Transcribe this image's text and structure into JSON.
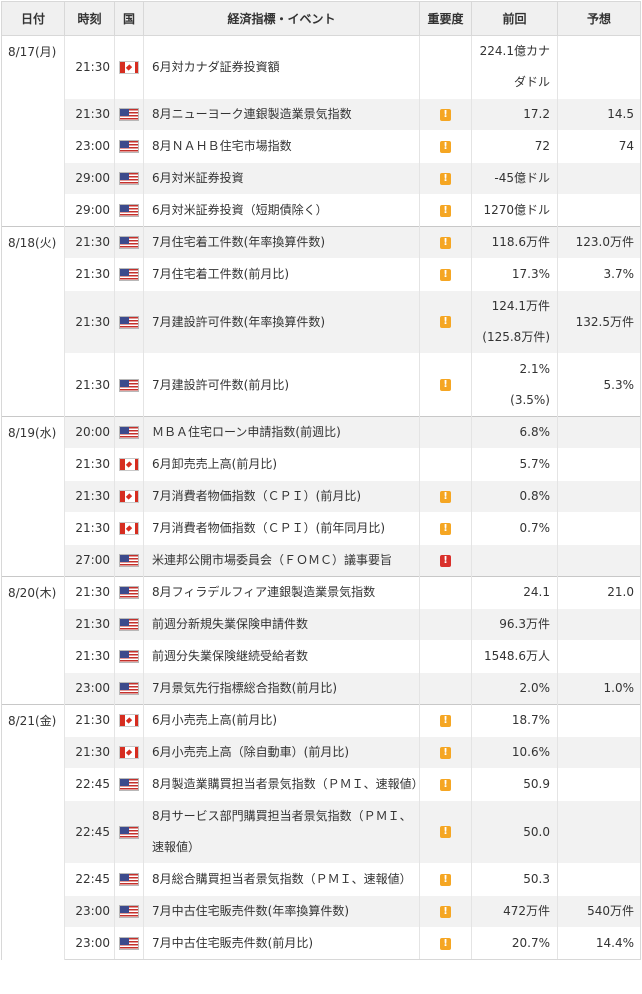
{
  "headers": {
    "date": "日付",
    "time": "時刻",
    "country": "国",
    "event": "経済指標・イベント",
    "importance": "重要度",
    "previous": "前回",
    "forecast": "予想"
  },
  "colors": {
    "importance_mid": "#f5a623",
    "importance_high": "#d9302b",
    "header_bg": "#f0f0f0",
    "alt_row_bg": "#f2f2f2"
  },
  "days": [
    {
      "date": "8/17(月)",
      "rows": [
        {
          "time": "21:30",
          "country": "canada-flag-icon",
          "event": "6月対カナダ証券投資額",
          "importance": "",
          "previous": "224.1億カナダドル",
          "forecast": ""
        },
        {
          "time": "21:30",
          "country": "us-flag-icon",
          "event": "8月ニューヨーク連銀製造業景気指数",
          "importance": "mid",
          "previous": "17.2",
          "forecast": "14.5"
        },
        {
          "time": "23:00",
          "country": "us-flag-icon",
          "event": "8月ＮＡＨＢ住宅市場指数",
          "importance": "mid",
          "previous": "72",
          "forecast": "74"
        },
        {
          "time": "29:00",
          "country": "us-flag-icon",
          "event": "6月対米証券投資",
          "importance": "mid",
          "previous": "-45億ドル",
          "forecast": ""
        },
        {
          "time": "29:00",
          "country": "us-flag-icon",
          "event": "6月対米証券投資（短期債除く）",
          "importance": "mid",
          "previous": "1270億ドル",
          "forecast": ""
        }
      ]
    },
    {
      "date": "8/18(火)",
      "rows": [
        {
          "time": "21:30",
          "country": "us-flag-icon",
          "event": "7月住宅着工件数(年率換算件数)",
          "importance": "mid",
          "previous": "118.6万件",
          "forecast": "123.0万件"
        },
        {
          "time": "21:30",
          "country": "us-flag-icon",
          "event": "7月住宅着工件数(前月比)",
          "importance": "mid",
          "previous": "17.3%",
          "forecast": "3.7%"
        },
        {
          "time": "21:30",
          "country": "us-flag-icon",
          "event": "7月建設許可件数(年率換算件数)",
          "importance": "mid",
          "previous": "124.1万件\n(125.8万件)",
          "forecast": "132.5万件"
        },
        {
          "time": "21:30",
          "country": "us-flag-icon",
          "event": "7月建設許可件数(前月比)",
          "importance": "mid",
          "previous": "2.1%\n(3.5%)",
          "forecast": "5.3%"
        }
      ]
    },
    {
      "date": "8/19(水)",
      "rows": [
        {
          "time": "20:00",
          "country": "us-flag-icon",
          "event": "ＭＢＡ住宅ローン申請指数(前週比)",
          "importance": "",
          "previous": "6.8%",
          "forecast": ""
        },
        {
          "time": "21:30",
          "country": "canada-flag-icon",
          "event": "6月卸売売上高(前月比)",
          "importance": "",
          "previous": "5.7%",
          "forecast": ""
        },
        {
          "time": "21:30",
          "country": "canada-flag-icon",
          "event": "7月消費者物価指数（ＣＰＩ）(前月比)",
          "importance": "mid",
          "previous": "0.8%",
          "forecast": ""
        },
        {
          "time": "21:30",
          "country": "canada-flag-icon",
          "event": "7月消費者物価指数（ＣＰＩ）(前年同月比)",
          "importance": "mid",
          "previous": "0.7%",
          "forecast": ""
        },
        {
          "time": "27:00",
          "country": "us-flag-icon",
          "event": "米連邦公開市場委員会（ＦＯＭＣ）議事要旨",
          "importance": "high",
          "previous": "",
          "forecast": ""
        }
      ]
    },
    {
      "date": "8/20(木)",
      "rows": [
        {
          "time": "21:30",
          "country": "us-flag-icon",
          "event": "8月フィラデルフィア連銀製造業景気指数",
          "importance": "",
          "previous": "24.1",
          "forecast": "21.0"
        },
        {
          "time": "21:30",
          "country": "us-flag-icon",
          "event": "前週分新規失業保険申請件数",
          "importance": "",
          "previous": "96.3万件",
          "forecast": ""
        },
        {
          "time": "21:30",
          "country": "us-flag-icon",
          "event": "前週分失業保険継続受給者数",
          "importance": "",
          "previous": "1548.6万人",
          "forecast": ""
        },
        {
          "time": "23:00",
          "country": "us-flag-icon",
          "event": "7月景気先行指標総合指数(前月比)",
          "importance": "",
          "previous": "2.0%",
          "forecast": "1.0%"
        }
      ]
    },
    {
      "date": "8/21(金)",
      "rows": [
        {
          "time": "21:30",
          "country": "canada-flag-icon",
          "event": "6月小売売上高(前月比)",
          "importance": "mid",
          "previous": "18.7%",
          "forecast": ""
        },
        {
          "time": "21:30",
          "country": "canada-flag-icon",
          "event": "6月小売売上高（除自動車）(前月比)",
          "importance": "mid",
          "previous": "10.6%",
          "forecast": ""
        },
        {
          "time": "22:45",
          "country": "us-flag-icon",
          "event": "8月製造業購買担当者景気指数（ＰＭＩ、速報値）",
          "importance": "mid",
          "previous": "50.9",
          "forecast": ""
        },
        {
          "time": "22:45",
          "country": "us-flag-icon",
          "event": "8月サービス部門購買担当者景気指数（ＰＭＩ、速報値）",
          "importance": "mid",
          "previous": "50.0",
          "forecast": ""
        },
        {
          "time": "22:45",
          "country": "us-flag-icon",
          "event": "8月総合購買担当者景気指数（ＰＭＩ、速報値）",
          "importance": "mid",
          "previous": "50.3",
          "forecast": ""
        },
        {
          "time": "23:00",
          "country": "us-flag-icon",
          "event": "7月中古住宅販売件数(年率換算件数)",
          "importance": "mid",
          "previous": "472万件",
          "forecast": "540万件"
        },
        {
          "time": "23:00",
          "country": "us-flag-icon",
          "event": "7月中古住宅販売件数(前月比)",
          "importance": "mid",
          "previous": "20.7%",
          "forecast": "14.4%"
        }
      ]
    }
  ]
}
